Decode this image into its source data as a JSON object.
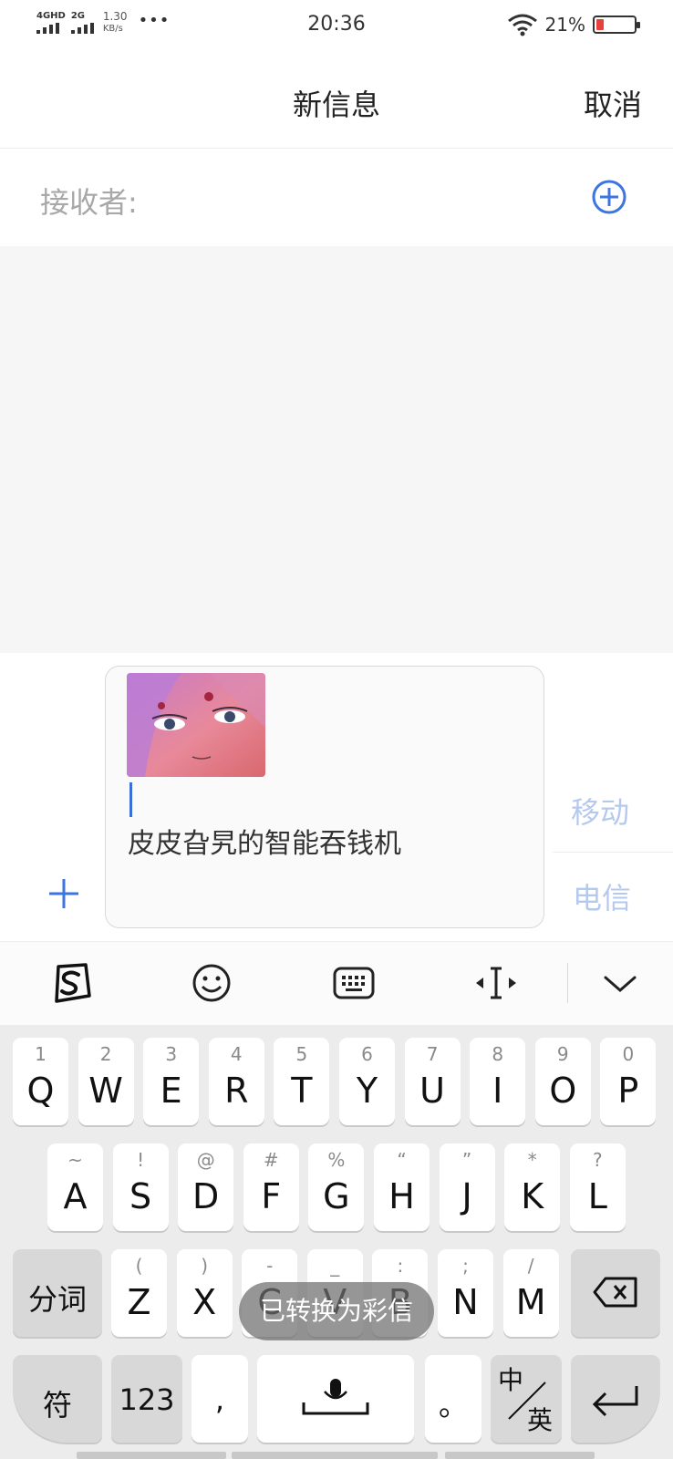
{
  "status_bar": {
    "network_1": "4GHD",
    "network_2": "2G",
    "speed_value": "1.30",
    "speed_unit": "KB/s",
    "more": "•••",
    "time": "20:36",
    "battery_pct": "21%",
    "battery_level": 0.21,
    "battery_color": "#e8403a"
  },
  "header": {
    "title": "新信息",
    "cancel": "取消"
  },
  "recipient": {
    "label": "接收者:",
    "add_icon": "plus-circle-icon"
  },
  "compose": {
    "message": "皮皮旮旯的智能吞钱机",
    "add_icon": "plus-icon",
    "sim_1": "移动",
    "sim_2": "电信"
  },
  "keyboard_toolbar": {
    "icons": [
      "sogou-logo-icon",
      "emoji-icon",
      "keyboard-icon",
      "cursor-move-icon",
      "chevron-down-icon"
    ]
  },
  "keyboard": {
    "row1": [
      {
        "main": "Q",
        "sub": "1"
      },
      {
        "main": "W",
        "sub": "2"
      },
      {
        "main": "E",
        "sub": "3"
      },
      {
        "main": "R",
        "sub": "4"
      },
      {
        "main": "T",
        "sub": "5"
      },
      {
        "main": "Y",
        "sub": "6"
      },
      {
        "main": "U",
        "sub": "7"
      },
      {
        "main": "I",
        "sub": "8"
      },
      {
        "main": "O",
        "sub": "9"
      },
      {
        "main": "P",
        "sub": "0"
      }
    ],
    "row2": [
      {
        "main": "A",
        "sub": "~"
      },
      {
        "main": "S",
        "sub": "!"
      },
      {
        "main": "D",
        "sub": "@"
      },
      {
        "main": "F",
        "sub": "#"
      },
      {
        "main": "G",
        "sub": "%"
      },
      {
        "main": "H",
        "sub": "“"
      },
      {
        "main": "J",
        "sub": "”"
      },
      {
        "main": "K",
        "sub": "*"
      },
      {
        "main": "L",
        "sub": "?"
      }
    ],
    "row3": [
      {
        "main": "Z",
        "sub": "("
      },
      {
        "main": "X",
        "sub": ")"
      },
      {
        "main": "C",
        "sub": "-"
      },
      {
        "main": "V",
        "sub": "_"
      },
      {
        "main": "B",
        "sub": ":"
      },
      {
        "main": "N",
        "sub": ";"
      },
      {
        "main": "M",
        "sub": "/"
      }
    ],
    "fenci": "分词",
    "symbol": "符",
    "num": "123",
    "comma": ",",
    "period": "。",
    "lang": "中",
    "lang_sub": "英",
    "toast": "已转换为彩信"
  }
}
